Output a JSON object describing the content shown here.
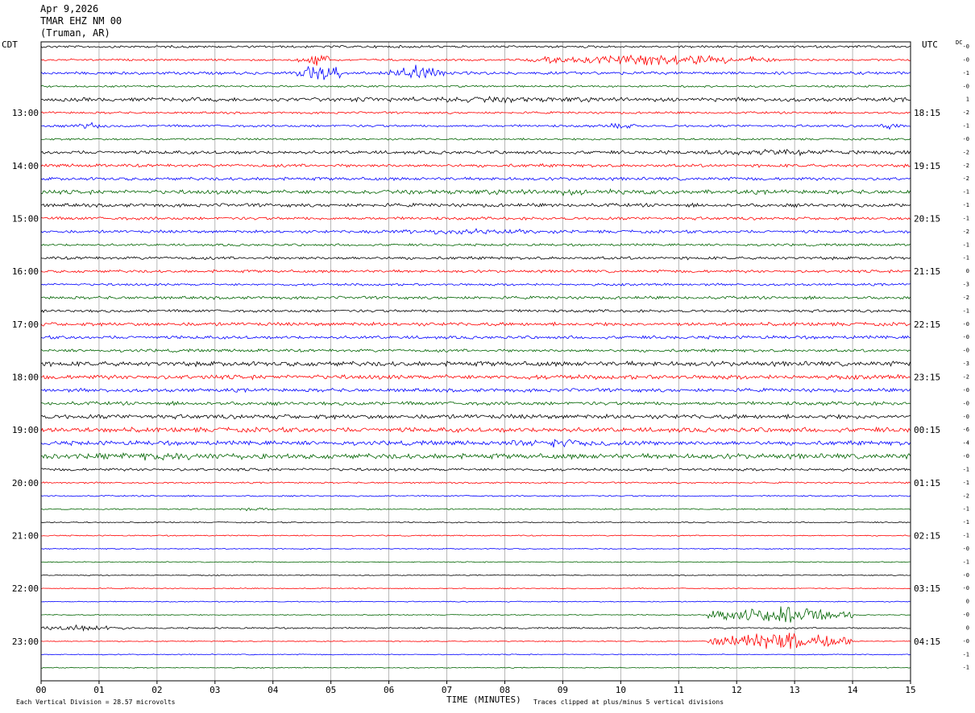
{
  "header": {
    "date": "Apr 9,2026",
    "station": "TMAR EHZ NM 00",
    "location": "(Truman, AR)"
  },
  "left_tz": "CDT",
  "right_tz": "UTC",
  "dc_label": "DC",
  "footer": {
    "scale_note": "Each Vertical Division =   28.57 microvolts",
    "xlabel": "TIME (MINUTES)",
    "clip_note": "Traces clipped at plus/minus 5 vertical divisions"
  },
  "colors": {
    "black": "#000000",
    "red": "#ff0000",
    "blue": "#0000ff",
    "green": "#006400",
    "grid": "#999999"
  },
  "chart_data": {
    "type": "line",
    "title": "Apr 9,2026 TMAR EHZ NM 00 (Truman, AR)",
    "xlabel": "TIME (MINUTES)",
    "xlim": [
      0,
      15
    ],
    "x_ticks": [
      "00",
      "01",
      "02",
      "03",
      "04",
      "05",
      "06",
      "07",
      "08",
      "09",
      "10",
      "11",
      "12",
      "13",
      "14",
      "15"
    ],
    "trace_minutes": 15,
    "row_colors": [
      "black",
      "red",
      "blue",
      "green"
    ],
    "left_labels": [
      "13:00",
      "14:00",
      "15:00",
      "16:00",
      "17:00",
      "18:00",
      "19:00",
      "20:00",
      "21:00",
      "22:00",
      "23:00"
    ],
    "left_label_rows": [
      5,
      9,
      13,
      17,
      21,
      25,
      29,
      33,
      37,
      41,
      45
    ],
    "right_labels": [
      "18:15",
      "19:15",
      "20:15",
      "21:15",
      "22:15",
      "23:15",
      "00:15",
      "01:15",
      "02:15",
      "03:15",
      "04:15"
    ],
    "right_label_rows": [
      5,
      9,
      13,
      17,
      21,
      25,
      29,
      33,
      37,
      41,
      45
    ],
    "dc_offsets": [
      "-0",
      "-0",
      "-1",
      "-0",
      "1",
      "-2",
      "-1",
      "-0",
      "-2",
      "-2",
      "-2",
      "-1",
      "-1",
      "-1",
      "-2",
      "-1",
      "-1",
      "0",
      "-3",
      "-2",
      "-1",
      "-0",
      "-0",
      "-0",
      "-3",
      "-2",
      "-0",
      "-0",
      "-0",
      "-6",
      "-4",
      "-0",
      "-1",
      "-1",
      "-2",
      "-1",
      "-1",
      "-1",
      "-0",
      "-1",
      "-0",
      "-0",
      "0",
      "-0",
      "0",
      "-0",
      "-1",
      "-1"
    ],
    "amplitude_levels": [
      1.2,
      1.0,
      1.5,
      1.0,
      2.0,
      1.1,
      1.2,
      1.0,
      1.7,
      1.6,
      1.6,
      2.1,
      1.8,
      1.5,
      1.5,
      1.2,
      1.5,
      1.4,
      1.2,
      1.5,
      1.4,
      1.8,
      1.6,
      1.5,
      2.4,
      2.2,
      1.8,
      1.8,
      2.2,
      2.4,
      2.2,
      2.6,
      1.4,
      0.8,
      0.7,
      0.7,
      0.6,
      0.6,
      0.5,
      0.5,
      0.5,
      0.5,
      0.5,
      0.5,
      0.8,
      0.5,
      0.5,
      0.5
    ],
    "events": [
      {
        "row": 1,
        "start_min": 4.4,
        "end_min": 5.0,
        "amp": 7
      },
      {
        "row": 2,
        "start_min": 4.4,
        "end_min": 5.2,
        "amp": 10
      },
      {
        "row": 2,
        "start_min": 6.0,
        "end_min": 7.0,
        "amp": 9
      },
      {
        "row": 1,
        "start_min": 8.2,
        "end_min": 12.8,
        "amp": 5
      },
      {
        "row": 4,
        "start_min": 3.8,
        "end_min": 12.0,
        "amp": 3
      },
      {
        "row": 6,
        "start_min": 0.5,
        "end_min": 1.2,
        "amp": 3
      },
      {
        "row": 6,
        "start_min": 9.7,
        "end_min": 10.3,
        "amp": 3
      },
      {
        "row": 6,
        "start_min": 14.4,
        "end_min": 14.9,
        "amp": 3
      },
      {
        "row": 8,
        "start_min": 10.5,
        "end_min": 15.0,
        "amp": 3
      },
      {
        "row": 11,
        "start_min": 5.5,
        "end_min": 12.0,
        "amp": 3
      },
      {
        "row": 14,
        "start_min": 5.5,
        "end_min": 9.5,
        "amp": 3
      },
      {
        "row": 30,
        "start_min": 7.5,
        "end_min": 10.5,
        "amp": 4
      },
      {
        "row": 31,
        "start_min": 0.0,
        "end_min": 4.5,
        "amp": 4
      },
      {
        "row": 35,
        "start_min": 3.4,
        "end_min": 4.0,
        "amp": 2
      },
      {
        "row": 43,
        "start_min": 11.5,
        "end_min": 14.0,
        "amp": 9
      },
      {
        "row": 44,
        "start_min": 0.0,
        "end_min": 1.5,
        "amp": 3
      },
      {
        "row": 45,
        "start_min": 11.5,
        "end_min": 14.0,
        "amp": 9
      }
    ]
  }
}
